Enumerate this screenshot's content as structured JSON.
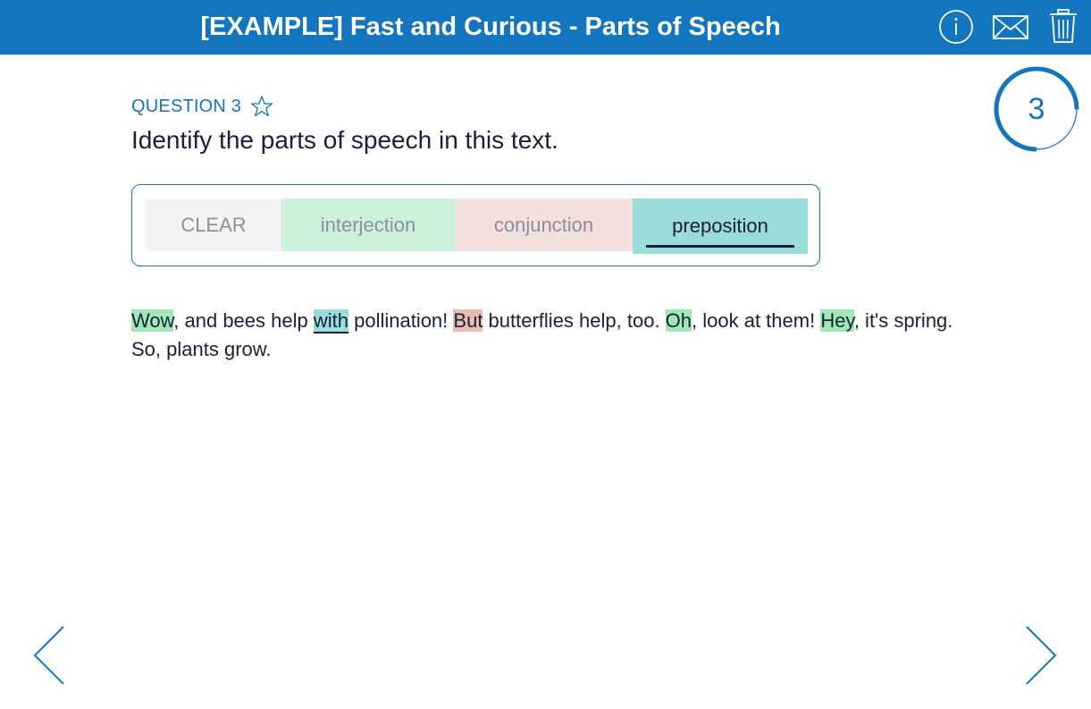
{
  "header": {
    "title": "[EXAMPLE] Fast and Curious - Parts of Speech",
    "icons": [
      "info-icon",
      "mail-icon",
      "trash-icon"
    ],
    "background_color": "#1275be"
  },
  "progress": {
    "number": "3",
    "ring_color": "#1275be",
    "fraction_complete": 0.75
  },
  "question": {
    "label": "QUESTION 3",
    "prompt": "Identify the parts of speech in this text."
  },
  "options": [
    {
      "label": "CLEAR",
      "color": "#f3f3f4"
    },
    {
      "label": "interjection",
      "color": "#cdf1d8"
    },
    {
      "label": "conjunction",
      "color": "#f2e0dc"
    },
    {
      "label": "preposition",
      "color": "#9adcd7",
      "selected": true
    }
  ],
  "passage": {
    "segments": [
      {
        "text": "Wow",
        "tag": "interjection"
      },
      {
        "text": ", and bees help "
      },
      {
        "text": "with",
        "tag": "preposition"
      },
      {
        "text": " pollination! "
      },
      {
        "text": "But",
        "tag": "conjunction"
      },
      {
        "text": " butterflies help, too. "
      },
      {
        "text": "Oh",
        "tag": "interjection"
      },
      {
        "text": ", look at them! "
      },
      {
        "text": "Hey",
        "tag": "interjection"
      },
      {
        "text": ", it's spring. So, plants grow."
      }
    ]
  },
  "colors": {
    "accent": "#1275be",
    "text": "#1a1f3d",
    "interjection_highlight": "#a0e8b4",
    "conjunction_highlight": "#e9bcb1",
    "preposition_highlight": "#9adcd7"
  }
}
